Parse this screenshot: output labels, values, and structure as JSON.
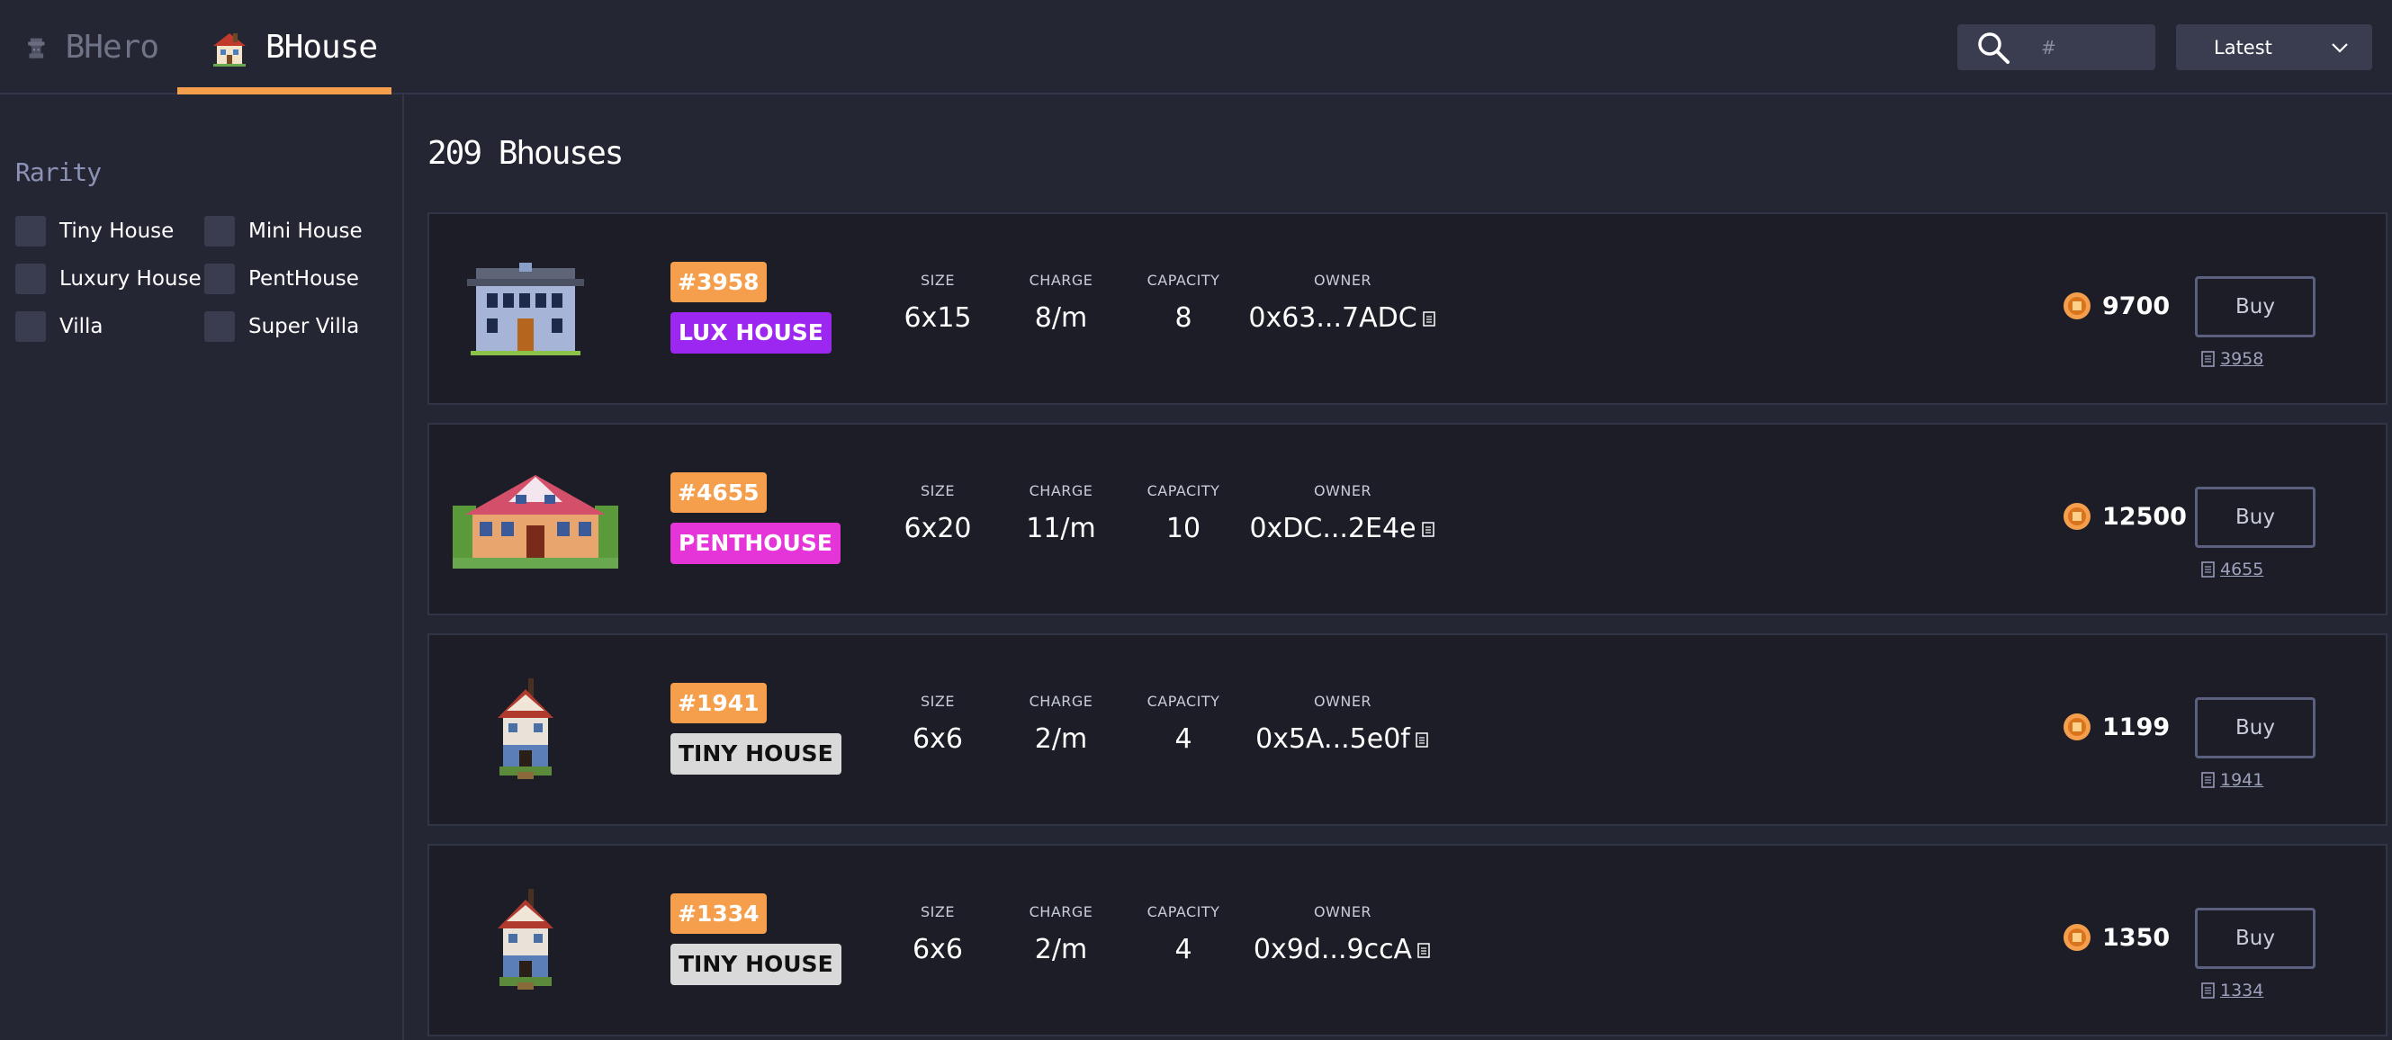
{
  "header": {
    "tabs": [
      {
        "label": "BHero",
        "active": false,
        "icon": "bhero-icon"
      },
      {
        "label": "BHouse",
        "active": true,
        "icon": "bhouse-icon"
      }
    ],
    "search": {
      "placeholder": "#",
      "value": ""
    },
    "sort": {
      "selected": "Latest"
    }
  },
  "sidebar": {
    "rarity_title": "Rarity",
    "filters": [
      {
        "label": "Tiny House",
        "checked": false
      },
      {
        "label": "Mini House",
        "checked": false
      },
      {
        "label": "Luxury House",
        "checked": false
      },
      {
        "label": "PentHouse",
        "checked": false
      },
      {
        "label": "Villa",
        "checked": false
      },
      {
        "label": "Super Villa",
        "checked": false
      }
    ]
  },
  "main": {
    "title": "209 Bhouses",
    "stat_labels": {
      "size": "SIZE",
      "charge": "CHARGE",
      "capacity": "CAPACITY",
      "owner": "OWNER"
    },
    "buy_label": "Buy",
    "listings": [
      {
        "id": "#3958",
        "rarity": "LUX HOUSE",
        "size": "6x15",
        "charge": "8/m",
        "capacity": "8",
        "owner": "0x63...7ADC",
        "price": "9700",
        "link_id": "3958"
      },
      {
        "id": "#4655",
        "rarity": "PENTHOUSE",
        "size": "6x20",
        "charge": "11/m",
        "capacity": "10",
        "owner": "0xDC...2E4e",
        "price": "12500",
        "link_id": "4655"
      },
      {
        "id": "#1941",
        "rarity": "TINY HOUSE",
        "size": "6x6",
        "charge": "2/m",
        "capacity": "4",
        "owner": "0x5A...5e0f",
        "price": "1199",
        "link_id": "1941"
      },
      {
        "id": "#1334",
        "rarity": "TINY HOUSE",
        "size": "6x6",
        "charge": "2/m",
        "capacity": "4",
        "owner": "0x9d...9ccA",
        "price": "1350",
        "link_id": "1334"
      }
    ]
  },
  "colors": {
    "accent": "#f59e4b",
    "lux_badge": "#9b27f0",
    "penthouse_badge": "#e535d8",
    "tiny_badge": "#d9d9d9",
    "background": "#242633",
    "card": "#1c1d27"
  }
}
